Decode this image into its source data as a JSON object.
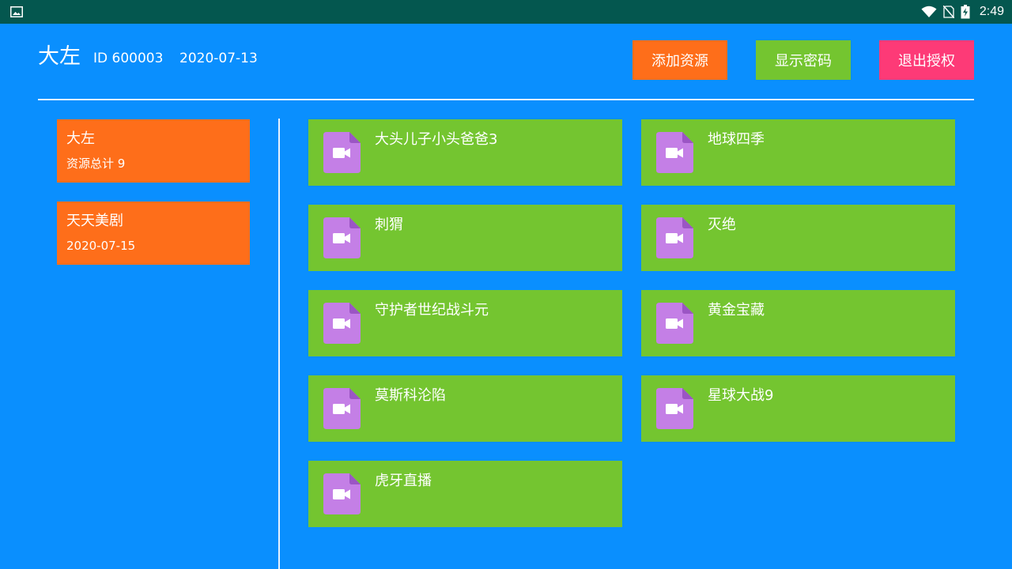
{
  "status_bar": {
    "time": "2:49",
    "icons": [
      "image-icon",
      "wifi-icon",
      "no-sim-icon",
      "battery-charging-icon"
    ]
  },
  "header": {
    "user_name": "大左",
    "user_id": "ID 600003",
    "date": "2020-07-13",
    "buttons": {
      "add_resource": "添加资源",
      "show_password": "显示密码",
      "logout": "退出授权"
    }
  },
  "sidebar": {
    "items": [
      {
        "title": "大左",
        "subtitle": "资源总计 9"
      },
      {
        "title": "天天美剧",
        "subtitle": "2020-07-15"
      }
    ]
  },
  "resources": {
    "items": [
      {
        "title": "大头儿子小头爸爸3",
        "icon": "video-file-icon"
      },
      {
        "title": "地球四季",
        "icon": "video-file-icon"
      },
      {
        "title": "刺猬",
        "icon": "video-file-icon"
      },
      {
        "title": "灭绝",
        "icon": "video-file-icon"
      },
      {
        "title": "守护者世纪战斗元",
        "icon": "video-file-icon"
      },
      {
        "title": "黄金宝藏",
        "icon": "video-file-icon"
      },
      {
        "title": "莫斯科沦陷",
        "icon": "video-file-icon"
      },
      {
        "title": "星球大战9",
        "icon": "video-file-icon"
      },
      {
        "title": "虎牙直播",
        "icon": "video-file-icon"
      }
    ]
  },
  "colors": {
    "background": "#0a8ffe",
    "status_bar": "#04574f",
    "orange": "#fe6e1a",
    "green": "#74c530",
    "pink": "#fd3a77",
    "file_icon": "#c47fe6"
  }
}
